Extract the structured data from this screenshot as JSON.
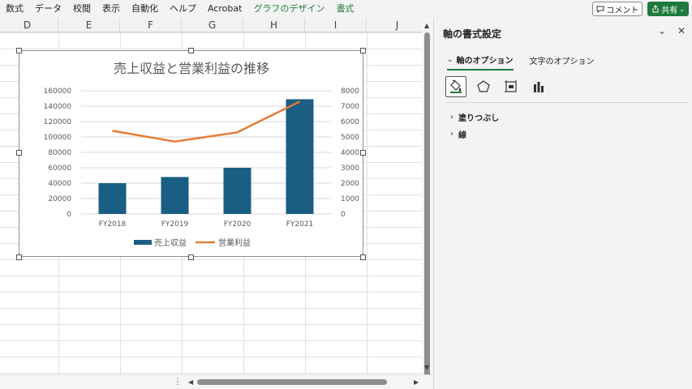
{
  "ribbon": {
    "tabs": [
      {
        "label": "数式",
        "accent": false
      },
      {
        "label": "データ",
        "accent": false
      },
      {
        "label": "校閲",
        "accent": false
      },
      {
        "label": "表示",
        "accent": false
      },
      {
        "label": "自動化",
        "accent": false
      },
      {
        "label": "ヘルプ",
        "accent": false
      },
      {
        "label": "Acrobat",
        "accent": false
      },
      {
        "label": "グラフのデザイン",
        "accent": true
      },
      {
        "label": "書式",
        "accent": true
      }
    ],
    "comment_label": "コメント",
    "share_label": "共有",
    "accent_color": "#1e7a3c"
  },
  "sheet": {
    "columns": [
      "D",
      "E",
      "F",
      "G",
      "H",
      "I",
      "J"
    ]
  },
  "chart_data": {
    "type": "bar",
    "title": "売上収益と営業利益の推移",
    "categories": [
      "FY2018",
      "FY2019",
      "FY2020",
      "FY2021"
    ],
    "series": [
      {
        "name": "売上収益",
        "kind": "bar",
        "axis": "left",
        "color": "#1a5e84",
        "values": [
          40000,
          48000,
          60000,
          149000
        ]
      },
      {
        "name": "営業利益",
        "kind": "line",
        "axis": "right",
        "color": "#e57a35",
        "values": [
          5400,
          4700,
          5300,
          7300
        ]
      }
    ],
    "ylim": [
      0,
      160000
    ],
    "yticks": [
      "0",
      "20000",
      "40000",
      "60000",
      "80000",
      "100000",
      "120000",
      "140000",
      "160000"
    ],
    "y2lim": [
      0,
      8000
    ],
    "y2ticks": [
      "0",
      "1000",
      "2000",
      "3000",
      "4000",
      "5000",
      "6000",
      "7000",
      "8000"
    ],
    "legend_position": "bottom",
    "grid": true
  },
  "pane": {
    "title": "軸の書式設定",
    "tabs": [
      {
        "label": "軸のオプション",
        "active": true
      },
      {
        "label": "文字のオプション",
        "active": false
      }
    ],
    "icons": [
      "fill-line-icon",
      "effects-icon",
      "size-properties-icon",
      "axis-options-icon"
    ],
    "sections": [
      {
        "label": "塗りつぶし"
      },
      {
        "label": "線"
      }
    ]
  }
}
